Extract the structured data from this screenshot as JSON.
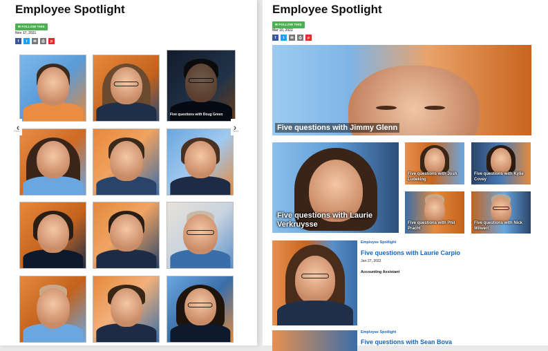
{
  "left_page": {
    "title": "Employee Spotlight",
    "follow_label": "FOLLOW THIS",
    "date": "Nov 17, 2021",
    "share_icons": [
      "facebook-icon",
      "twitter-icon",
      "email-icon",
      "print-icon",
      "pinterest-icon"
    ],
    "carousel": {
      "prev_label": "Prev",
      "next_label": "Next",
      "hover_caption": "Five questions with Doug Green"
    }
  },
  "right_page": {
    "title": "Employee Spotlight",
    "follow_label": "FOLLOW THIS",
    "date": "Mar 10, 2022",
    "share_icons": [
      "facebook-icon",
      "twitter-icon",
      "email-icon",
      "print-icon",
      "pinterest-icon"
    ],
    "hero_caption": "Five questions with Jimmy Glenn",
    "feature_caption": "Five questions with Laurie Verkruysse",
    "small_tiles": [
      {
        "caption": "Five questions with Josh Ludeking"
      },
      {
        "caption": "Five questions with Kylie Covey"
      },
      {
        "caption": "Five questions with Phil Pracht"
      },
      {
        "caption": "Five questions with Nick Wilwert"
      }
    ],
    "articles": [
      {
        "category": "Employee Spotlight",
        "title": "Five questions with Laurie Carpio",
        "date": "Jan 27, 2022",
        "subtitle": "Accounting Assistant"
      },
      {
        "category": "Employee Spotlight",
        "title": "Five questions with Sean Bova"
      }
    ]
  },
  "colors": {
    "orange": "#e07a2c",
    "blue": "#4a90d9",
    "follow_green": "#4caf50",
    "link_blue": "#1565c0"
  }
}
